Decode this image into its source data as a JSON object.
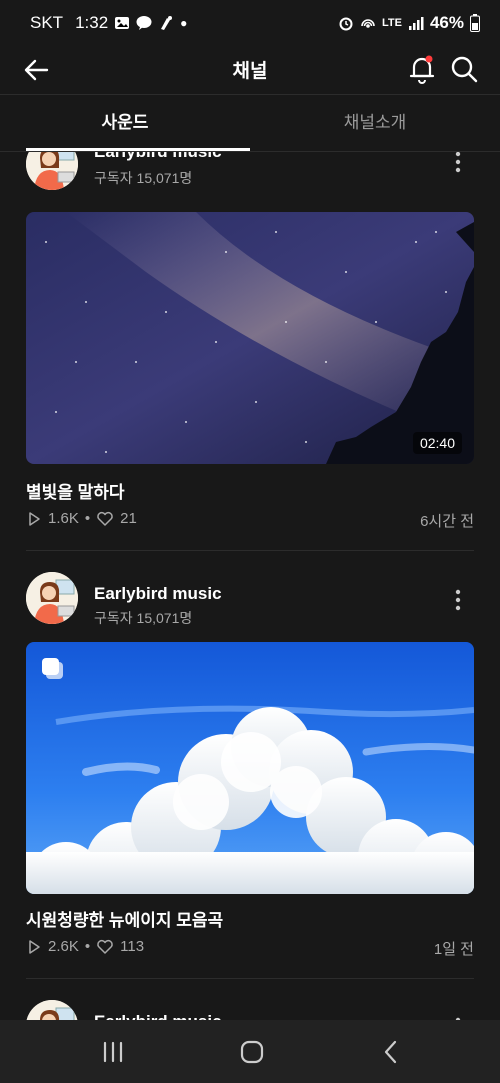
{
  "status_bar": {
    "carrier": "SKT",
    "time": "1:32",
    "network": "LTE",
    "battery": "46%"
  },
  "header": {
    "title": "채널"
  },
  "tabs": [
    {
      "label": "사운드",
      "active": true
    },
    {
      "label": "채널소개",
      "active": false
    }
  ],
  "posts": [
    {
      "channel": "Earlybird music",
      "subscribers": "구독자 15,071명",
      "title": "별빛을 말하다",
      "duration": "02:40",
      "plays": "1.6K",
      "likes": "21",
      "time": "6시간 전",
      "thumb": "night-sky"
    },
    {
      "channel": "Earlybird music",
      "subscribers": "구독자 15,071명",
      "title": "시원청량한 뉴에이지 모음곡",
      "plays": "2.6K",
      "likes": "113",
      "time": "1일 전",
      "thumb": "blue-sky-clouds"
    },
    {
      "channel": "Earlybird music"
    }
  ],
  "colors": {
    "background": "#181818",
    "notification_dot": "#ff3b3b"
  },
  "icons": [
    "back-arrow-icon",
    "bell-icon",
    "search-icon",
    "more-vert-icon",
    "play-icon",
    "heart-icon",
    "multi-image-icon",
    "recent-apps-icon",
    "home-icon",
    "nav-back-icon"
  ]
}
